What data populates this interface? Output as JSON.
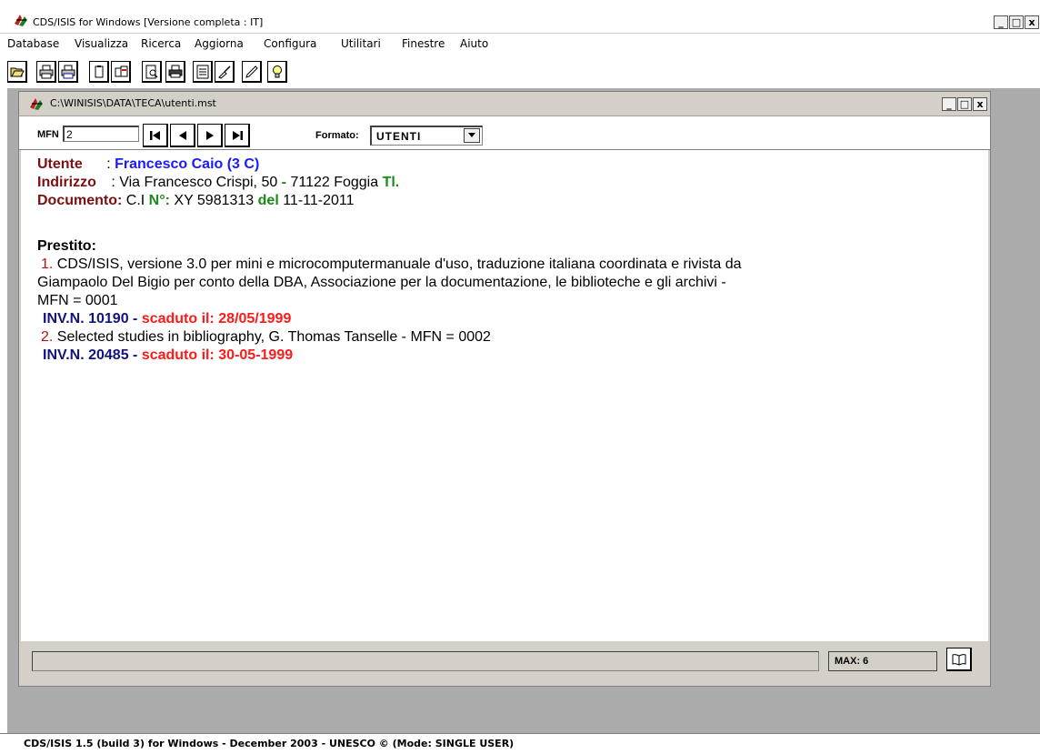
{
  "app": {
    "title": "CDS/ISIS for Windows [Versione completa : IT]",
    "status_text": "CDS/ISIS 1.5 (build 3) for Windows - December 2003 - UNESCO © (Mode: SINGLE USER)",
    "window_controls": {
      "minimize": "_",
      "maximize": "□",
      "close": "x"
    }
  },
  "menu": {
    "items": [
      "Database",
      "Visualizza",
      "Ricerca",
      "Aggiorna",
      "Configura",
      "Utilitari",
      "Finestre",
      "Aiuto"
    ]
  },
  "toolbar": {
    "icons": [
      "open-folder-icon",
      "print-txt-icon",
      "print-rtf-icon",
      "copy-icon",
      "copy-rtf-icon",
      "preview-icon",
      "printer-icon",
      "form-icon",
      "edit-brush-icon",
      "pencil-icon",
      "lightbulb-icon"
    ]
  },
  "child_window": {
    "title": "C:\\WINISIS\\DATA\\TECA\\utenti.mst",
    "mfn_label": "MFN",
    "mfn_value": "2",
    "format_label": "Formato:",
    "format_value": "UTENTI",
    "max_label": "MAX: 6"
  },
  "record": {
    "utente_label": "Utente",
    "utente_sep": " : ",
    "utente_value": "Francesco Caio (3 C)",
    "indirizzo_label": "Indirizzo",
    "indirizzo_sep": " : ",
    "indirizzo_value_1": "Via Francesco Crispi, 50",
    "indirizzo_dash": " - ",
    "indirizzo_value_2": "71122 Foggia ",
    "tel_label": "Tl.",
    "documento_label": "Documento:",
    "documento_value": " C.I ",
    "numero_label": "N°:",
    "numero_value": " XY 5981313 ",
    "del_label": "del",
    "del_value": " 11-11-2011",
    "prestito_label": "Prestito:",
    "loans": [
      {
        "num": "1.",
        "line1": " CDS/ISIS, versione 3.0 per mini e microcomputermanuale d'uso, traduzione italiana coordinata e rivista da",
        "line2": "Giampaolo Del Bigio per conto della DBA, Associazione per la documentazione, le biblioteche e gli archivi -",
        "line3": "MFN = 0001",
        "inv": "INV.N. 10190 - ",
        "scaduto": " scaduto il: 28/05/1999"
      },
      {
        "num": "2.",
        "line1": " Selected studies in bibliography, G. Thomas Tanselle - MFN = 0002",
        "inv": "INV.N. 20485 - ",
        "scaduto": " scaduto il: 30-05-1999"
      }
    ]
  }
}
